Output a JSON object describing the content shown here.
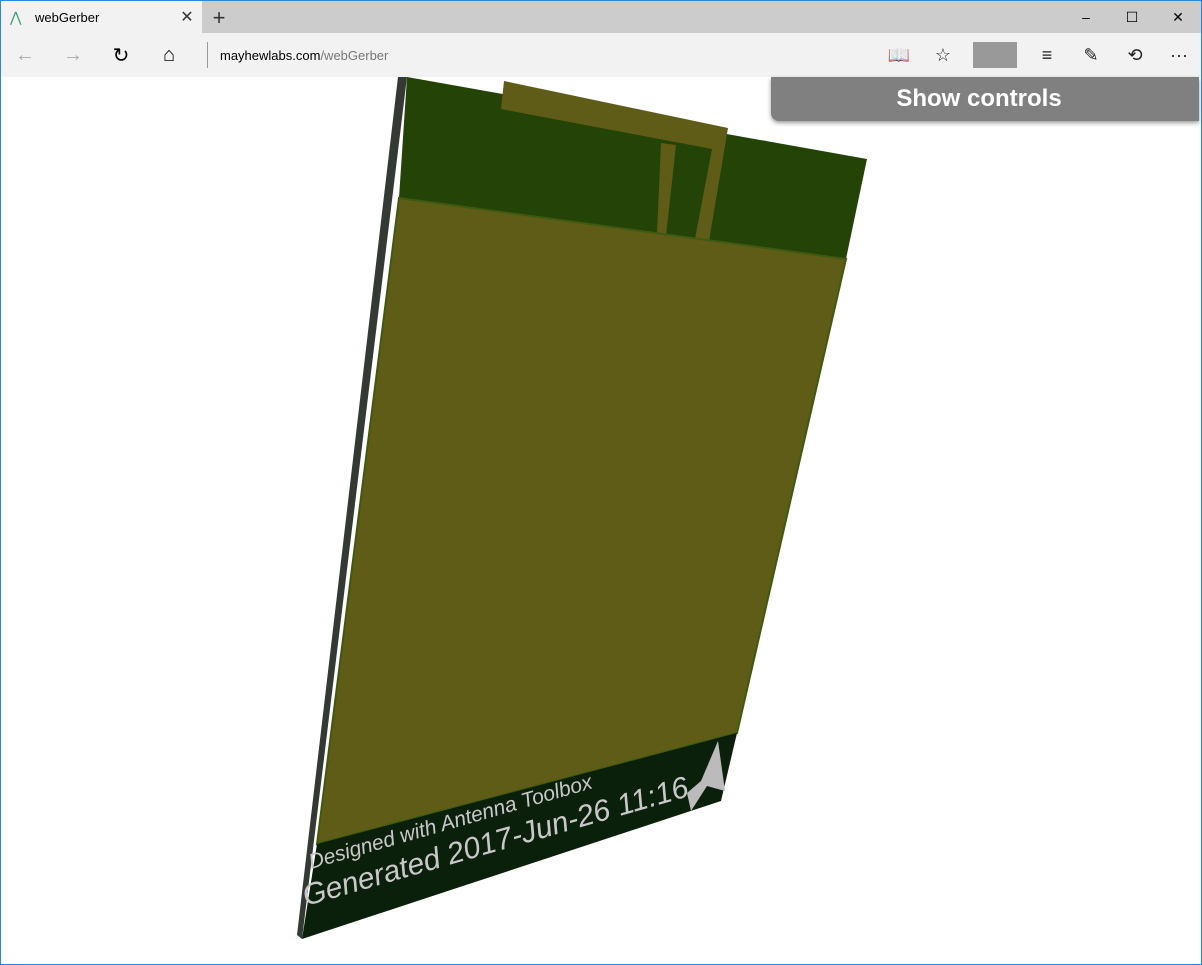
{
  "tab": {
    "title": "webGerber",
    "close_icon": "close-icon",
    "new_tab_icon": "plus-icon"
  },
  "window": {
    "minimize": "–",
    "maximize": "☐",
    "close": "✕"
  },
  "nav": {
    "back": "←",
    "forward": "→",
    "refresh": "↻",
    "home": "⌂"
  },
  "address": {
    "domain": "mayhewlabs.com",
    "path": "/webGerber"
  },
  "toolbar": {
    "reading": "📖",
    "favorite": "☆",
    "hub": "≡",
    "notes": "✎",
    "share": "⟲",
    "more": "···"
  },
  "controls_label": "Show controls",
  "board": {
    "line1": "Designed with Antenna Toolbox",
    "line2": "Generated 2017-Jun-26 11:16",
    "colors": {
      "copper": "#5f5c17",
      "mask": "#244407",
      "silk": "#0b200b",
      "edge": "#333a33"
    }
  }
}
